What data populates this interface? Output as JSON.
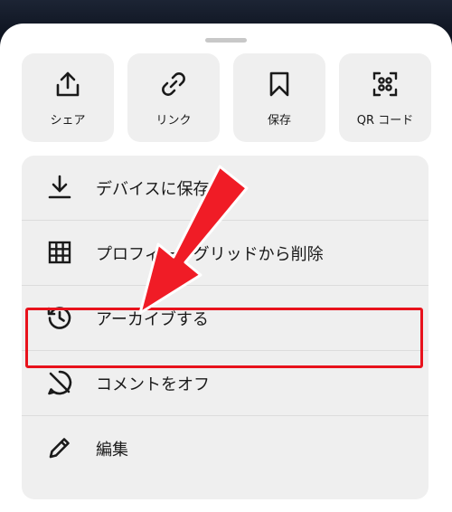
{
  "quick_actions": [
    {
      "label": "シェア",
      "icon": "share-icon"
    },
    {
      "label": "リンク",
      "icon": "link-icon"
    },
    {
      "label": "保存",
      "icon": "bookmark-icon"
    },
    {
      "label": "QR コード",
      "icon": "qr-code-icon"
    }
  ],
  "menu": {
    "items": [
      {
        "label": "デバイスに保存",
        "icon": "download-icon"
      },
      {
        "label": "プロフィールグリッドから削除",
        "icon": "grid-icon"
      },
      {
        "label": "アーカイブする",
        "icon": "archive-history-icon"
      },
      {
        "label": "コメントをオフ",
        "icon": "comment-off-icon"
      },
      {
        "label": "編集",
        "icon": "pencil-icon"
      }
    ]
  },
  "annotation": {
    "highlight_color": "#e8121c",
    "highlighted_item": "アーカイブする"
  },
  "colors": {
    "sheet": "#ffffff",
    "button_bg": "#efefef",
    "text": "#1a1a1a",
    "backdrop": "#0e1420"
  }
}
